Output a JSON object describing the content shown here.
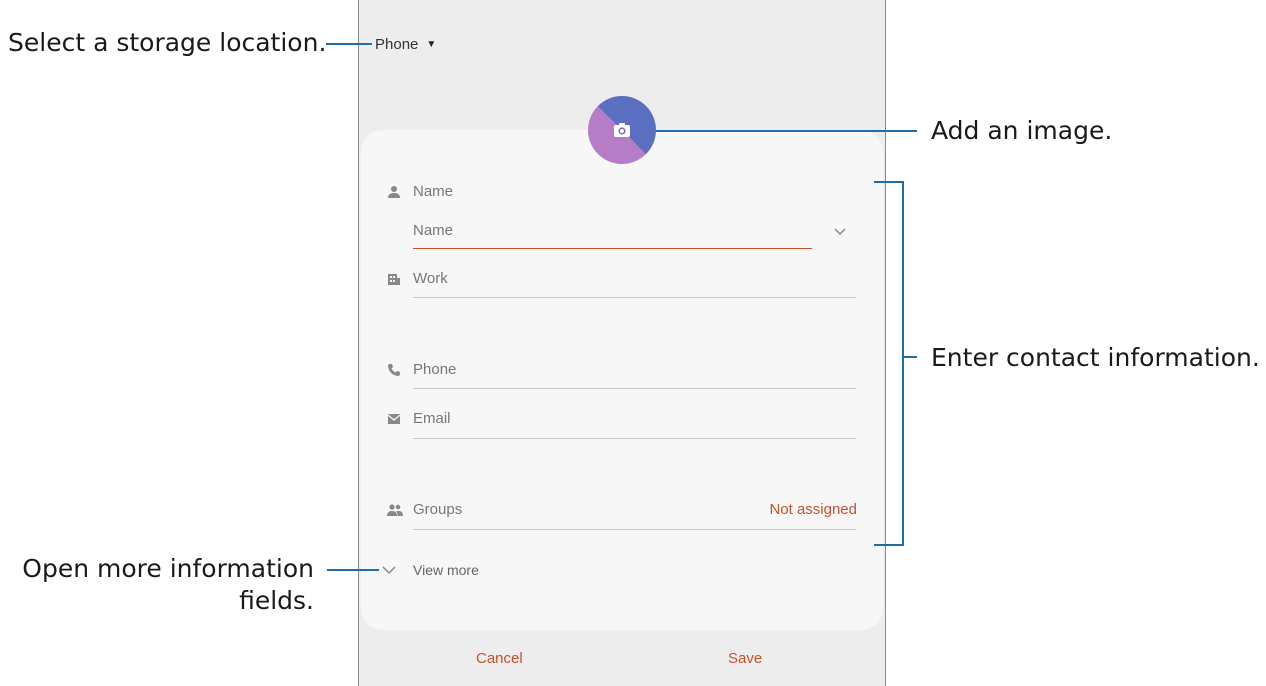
{
  "screen": {
    "storage": {
      "label": "Phone",
      "caret": "▼"
    },
    "fields": {
      "name_label": "Name",
      "name_input_placeholder": "Name",
      "work_label": "Work",
      "phone_label": "Phone",
      "email_label": "Email",
      "groups_label": "Groups",
      "groups_value": "Not assigned",
      "view_more_label": "View more"
    },
    "footer": {
      "cancel_label": "Cancel",
      "save_label": "Save"
    },
    "colors": {
      "accent": "#c5532a",
      "callout_line": "#1f6fa6"
    },
    "icons": [
      "camera-icon",
      "person-icon",
      "building-icon",
      "phone-icon",
      "email-icon",
      "groups-icon",
      "chevron-down-icon"
    ]
  },
  "callouts": {
    "storage": "Select a storage location.",
    "image": "Add an image.",
    "contact": "Enter contact information.",
    "more_line1": "Open more information",
    "more_line2": "fields."
  }
}
